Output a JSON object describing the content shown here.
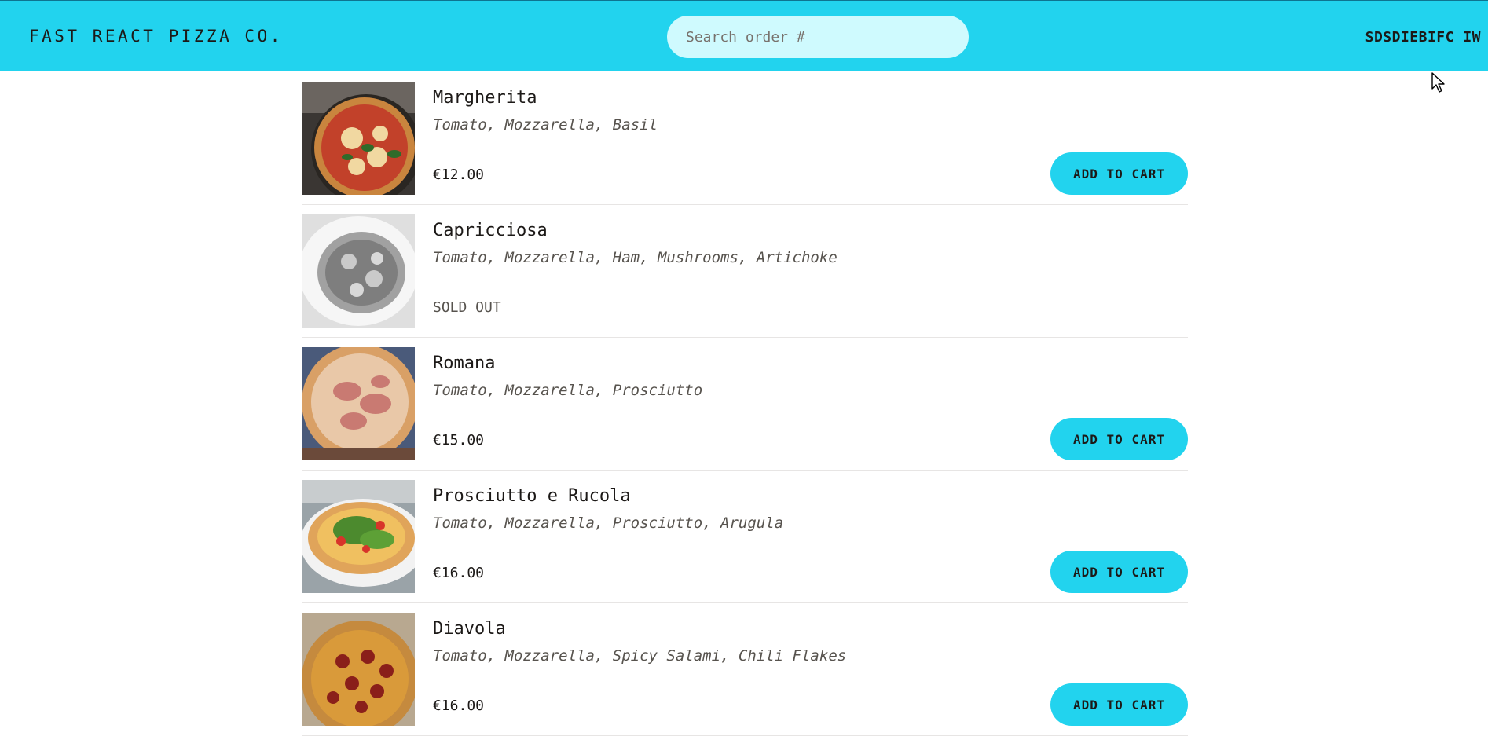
{
  "header": {
    "logo": "Fast React Pizza Co.",
    "search_placeholder": "Search order #",
    "username": "SDSDIEBIFC IW"
  },
  "menu": {
    "add_to_cart_label": "Add to cart",
    "sold_out_label": "Sold out",
    "items": [
      {
        "name": "Margherita",
        "ingredients": "Tomato, Mozzarella, Basil",
        "price": "€12.00",
        "sold_out": false,
        "image": "pizza-margherita"
      },
      {
        "name": "Capricciosa",
        "ingredients": "Tomato, Mozzarella, Ham, Mushrooms, Artichoke",
        "price": "",
        "sold_out": true,
        "image": "pizza-capricciosa"
      },
      {
        "name": "Romana",
        "ingredients": "Tomato, Mozzarella, Prosciutto",
        "price": "€15.00",
        "sold_out": false,
        "image": "pizza-romana"
      },
      {
        "name": "Prosciutto e Rucola",
        "ingredients": "Tomato, Mozzarella, Prosciutto, Arugula",
        "price": "€16.00",
        "sold_out": false,
        "image": "pizza-prosciutto-rucola"
      },
      {
        "name": "Diavola",
        "ingredients": "Tomato, Mozzarella, Spicy Salami, Chili Flakes",
        "price": "€16.00",
        "sold_out": false,
        "image": "pizza-diavola"
      }
    ]
  },
  "colors": {
    "brand": "#22d3ee",
    "search_bg": "#cffafe",
    "text": "#1c1917",
    "muted": "#57534e",
    "divider": "#e7e5e4"
  }
}
